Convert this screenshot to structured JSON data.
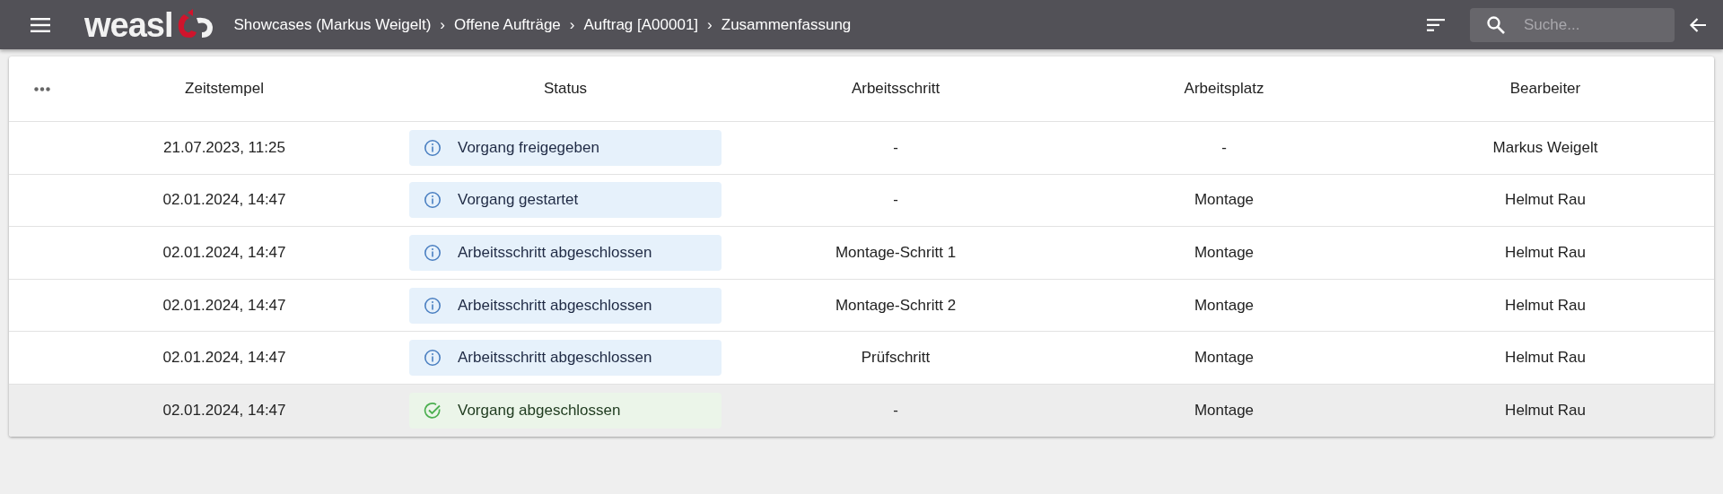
{
  "header": {
    "logo": "weasl",
    "breadcrumb": [
      "Showcases (Markus Weigelt)",
      "Offene Aufträge",
      "Auftrag [A00001]",
      "Zusammenfassung"
    ],
    "separator": "›",
    "search": {
      "placeholder": "Suche..."
    }
  },
  "table": {
    "columns": [
      "Zeitstempel",
      "Status",
      "Arbeitsschritt",
      "Arbeitsplatz",
      "Bearbeiter"
    ],
    "rows": [
      {
        "selected": false,
        "cells": [
          "21.07.2023, 11:25",
          {
            "kind": "info",
            "text": "Vorgang freigegeben"
          },
          "-",
          "-",
          "Markus Weigelt"
        ]
      },
      {
        "selected": false,
        "cells": [
          "02.01.2024, 14:47",
          {
            "kind": "info",
            "text": "Vorgang gestartet"
          },
          "-",
          "Montage",
          "Helmut Rau"
        ]
      },
      {
        "selected": false,
        "cells": [
          "02.01.2024, 14:47",
          {
            "kind": "info",
            "text": "Arbeitsschritt abgeschlossen"
          },
          "Montage-Schritt 1",
          "Montage",
          "Helmut Rau"
        ]
      },
      {
        "selected": false,
        "cells": [
          "02.01.2024, 14:47",
          {
            "kind": "info",
            "text": "Arbeitsschritt abgeschlossen"
          },
          "Montage-Schritt 2",
          "Montage",
          "Helmut Rau"
        ]
      },
      {
        "selected": false,
        "cells": [
          "02.01.2024, 14:47",
          {
            "kind": "info",
            "text": "Arbeitsschritt abgeschlossen"
          },
          "Prüfschritt",
          "Montage",
          "Helmut Rau"
        ]
      },
      {
        "selected": true,
        "cells": [
          "02.01.2024, 14:47",
          {
            "kind": "success",
            "text": "Vorgang abgeschlossen"
          },
          "-",
          "Montage",
          "Helmut Rau"
        ]
      }
    ]
  }
}
